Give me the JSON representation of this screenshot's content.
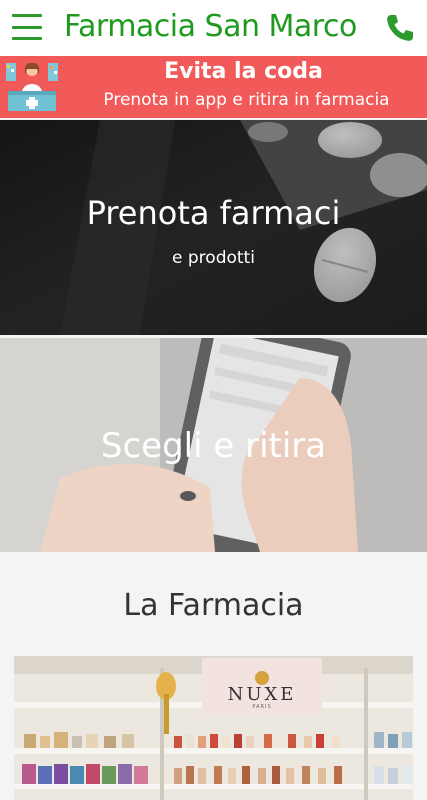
{
  "header": {
    "title": "Farmacia San Marco",
    "menu_icon": "hamburger-menu-icon",
    "phone_icon": "phone-icon",
    "accent_color": "#1f9a1f"
  },
  "banner": {
    "title": "Evita la coda",
    "subtitle": "Prenota in app e ritira in farmacia",
    "background": "#f25a5a",
    "icon": "pharmacist-counter-icon"
  },
  "tiles": [
    {
      "title": "Prenota farmaci",
      "subtitle": "e prodotti"
    },
    {
      "title": "Scegli e ritira"
    }
  ],
  "section": {
    "title": "La Farmacia",
    "photo_brand": "NUXE",
    "photo_brand_sub": "PARIS"
  }
}
